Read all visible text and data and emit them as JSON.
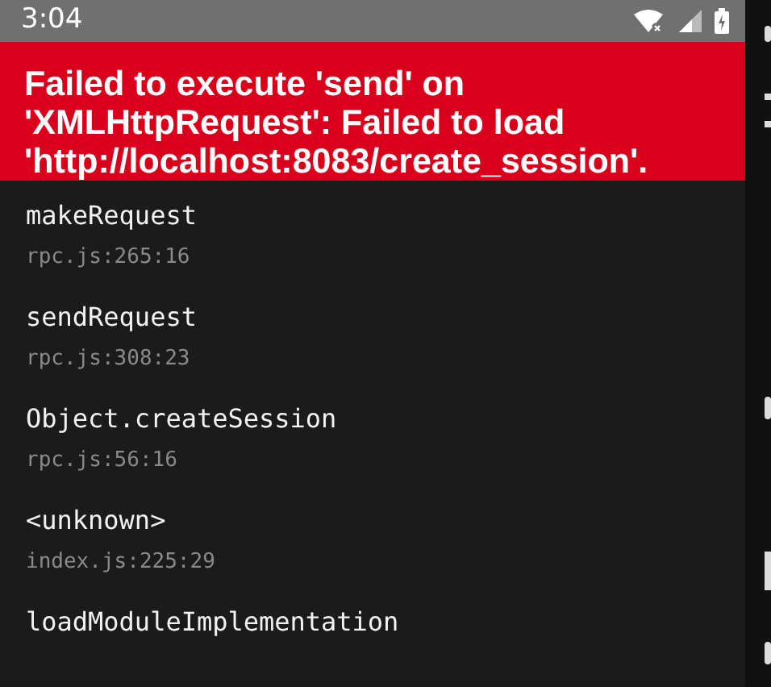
{
  "status_bar": {
    "time": "3:04"
  },
  "error": {
    "message": "Failed to execute 'send' on 'XMLHttpRequest': Failed to load 'http://localhost:8083/create_session'."
  },
  "stack_frames": [
    {
      "method": "makeRequest",
      "location": "rpc.js:265:16"
    },
    {
      "method": "sendRequest",
      "location": "rpc.js:308:23"
    },
    {
      "method": "Object.createSession",
      "location": "rpc.js:56:16"
    },
    {
      "method": "<unknown>",
      "location": "index.js:225:29"
    },
    {
      "method": "loadModuleImplementation"
    }
  ]
}
